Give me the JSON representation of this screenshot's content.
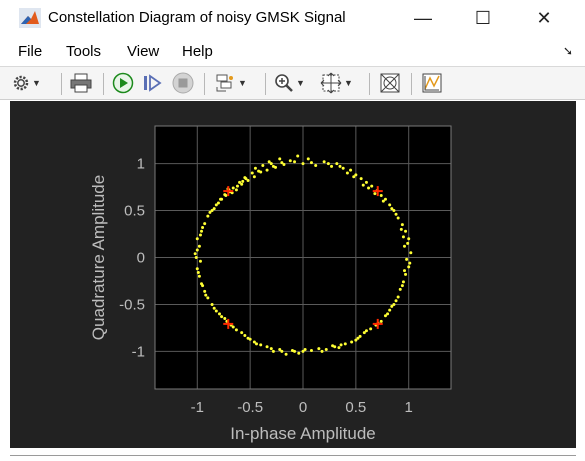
{
  "window": {
    "title": "Constellation Diagram of noisy GMSK Signal",
    "buttons": {
      "minimize": "—",
      "maximize": "☐",
      "close": "✕"
    }
  },
  "menu": {
    "items": [
      "File",
      "Tools",
      "View",
      "Help"
    ],
    "overflow_icon": "dock-arrow-icon"
  },
  "toolbar": {
    "buttons": [
      {
        "icon": "gear-icon",
        "dropdown": true
      },
      {
        "icon": "print-icon",
        "dropdown": false
      },
      {
        "icon": "run-icon",
        "dropdown": false
      },
      {
        "icon": "step-forward-icon",
        "dropdown": false
      },
      {
        "icon": "stop-icon",
        "dropdown": false
      },
      {
        "icon": "highlight-icon",
        "dropdown": true
      },
      {
        "icon": "zoom-in-icon",
        "dropdown": true
      },
      {
        "icon": "scale-axes-icon",
        "dropdown": true
      },
      {
        "icon": "measurements-icon",
        "dropdown": false
      },
      {
        "icon": "triggers-icon",
        "dropdown": false
      }
    ]
  },
  "chart_data": {
    "type": "scatter",
    "xlabel": "In-phase Amplitude",
    "ylabel": "Quadrature Amplitude",
    "xlim": [
      -1.4,
      1.4
    ],
    "ylim": [
      -1.4,
      1.4
    ],
    "xticks": [
      -1,
      -0.5,
      0,
      0.5,
      1
    ],
    "xtick_labels": [
      "-1",
      "-0.5",
      "0",
      "0.5",
      "1"
    ],
    "yticks": [
      1,
      0.5,
      0,
      -0.5,
      -1
    ],
    "ytick_labels": [
      "1",
      "0.5",
      "0",
      "-0.5",
      "-1"
    ],
    "grid": true,
    "reference_points": [
      {
        "x": -0.707,
        "y": 0.707
      },
      {
        "x": 0.707,
        "y": 0.707
      },
      {
        "x": -0.707,
        "y": -0.707
      },
      {
        "x": 0.707,
        "y": -0.707
      }
    ],
    "received_points": [
      [
        -0.71,
        0.73
      ],
      [
        -0.69,
        0.7
      ],
      [
        -0.74,
        0.67
      ],
      [
        -0.66,
        0.74
      ],
      [
        -0.78,
        0.62
      ],
      [
        -0.6,
        0.8
      ],
      [
        -0.55,
        0.85
      ],
      [
        -0.48,
        0.9
      ],
      [
        -0.45,
        0.95
      ],
      [
        -0.38,
        0.98
      ],
      [
        -0.32,
        1.02
      ],
      [
        -0.28,
        0.97
      ],
      [
        -0.22,
        1.05
      ],
      [
        -0.18,
        0.99
      ],
      [
        -0.12,
        1.03
      ],
      [
        -0.05,
        1.08
      ],
      [
        0.0,
        1.0
      ],
      [
        0.05,
        1.05
      ],
      [
        0.12,
        0.98
      ],
      [
        0.2,
        1.02
      ],
      [
        0.27,
        0.97
      ],
      [
        0.32,
        1.0
      ],
      [
        0.38,
        0.95
      ],
      [
        0.45,
        0.93
      ],
      [
        0.5,
        0.88
      ],
      [
        0.55,
        0.84
      ],
      [
        0.6,
        0.8
      ],
      [
        0.65,
        0.76
      ],
      [
        0.7,
        0.71
      ],
      [
        0.74,
        0.66
      ],
      [
        0.78,
        0.62
      ],
      [
        0.82,
        0.56
      ],
      [
        0.86,
        0.5
      ],
      [
        0.9,
        0.42
      ],
      [
        0.94,
        0.35
      ],
      [
        0.97,
        0.28
      ],
      [
        1.0,
        0.2
      ],
      [
        0.96,
        0.12
      ],
      [
        1.02,
        0.05
      ],
      [
        0.98,
        -0.02
      ],
      [
        1.0,
        -0.1
      ],
      [
        0.97,
        -0.18
      ],
      [
        0.95,
        -0.26
      ],
      [
        0.92,
        -0.34
      ],
      [
        0.9,
        -0.42
      ],
      [
        0.86,
        -0.5
      ],
      [
        0.82,
        -0.56
      ],
      [
        0.78,
        -0.62
      ],
      [
        0.74,
        -0.68
      ],
      [
        0.69,
        -0.72
      ],
      [
        0.64,
        -0.76
      ],
      [
        0.58,
        -0.8
      ],
      [
        0.52,
        -0.86
      ],
      [
        0.46,
        -0.9
      ],
      [
        0.4,
        -0.92
      ],
      [
        0.34,
        -0.96
      ],
      [
        0.28,
        -0.94
      ],
      [
        0.22,
        -0.98
      ],
      [
        0.15,
        -0.97
      ],
      [
        0.08,
        -0.99
      ],
      [
        0.02,
        -0.98
      ],
      [
        -0.04,
        -1.02
      ],
      [
        -0.1,
        -0.99
      ],
      [
        -0.16,
        -1.03
      ],
      [
        -0.22,
        -0.98
      ],
      [
        -0.28,
        -1.0
      ],
      [
        -0.34,
        -0.95
      ],
      [
        -0.4,
        -0.93
      ],
      [
        -0.46,
        -0.9
      ],
      [
        -0.52,
        -0.86
      ],
      [
        -0.58,
        -0.8
      ],
      [
        -0.63,
        -0.77
      ],
      [
        -0.68,
        -0.72
      ],
      [
        -0.72,
        -0.68
      ],
      [
        -0.77,
        -0.63
      ],
      [
        -0.82,
        -0.57
      ],
      [
        -0.86,
        -0.5
      ],
      [
        -0.9,
        -0.43
      ],
      [
        -0.93,
        -0.36
      ],
      [
        -0.96,
        -0.28
      ],
      [
        -0.98,
        -0.2
      ],
      [
        -1.0,
        -0.12
      ],
      [
        -0.97,
        -0.04
      ],
      [
        -1.02,
        0.04
      ],
      [
        -0.98,
        0.12
      ],
      [
        -1.0,
        0.2
      ],
      [
        -0.96,
        0.28
      ],
      [
        -0.93,
        0.36
      ],
      [
        -0.9,
        0.44
      ],
      [
        -0.86,
        0.5
      ],
      [
        -0.82,
        0.56
      ],
      [
        -0.77,
        0.62
      ],
      [
        -0.73,
        0.66
      ],
      [
        -0.67,
        0.69
      ],
      [
        -0.63,
        0.72
      ],
      [
        -0.58,
        0.78
      ],
      [
        -0.52,
        0.82
      ],
      [
        -0.46,
        0.86
      ],
      [
        -0.4,
        0.91
      ],
      [
        -0.34,
        0.93
      ],
      [
        0.42,
        0.9
      ],
      [
        0.48,
        0.86
      ],
      [
        0.57,
        0.77
      ],
      [
        0.62,
        0.74
      ],
      [
        0.68,
        0.68
      ],
      [
        0.76,
        0.6
      ],
      [
        0.84,
        0.52
      ],
      [
        0.93,
        0.3
      ],
      [
        0.99,
        0.15
      ],
      [
        1.01,
        -0.06
      ],
      [
        0.94,
        -0.3
      ],
      [
        0.88,
        -0.46
      ],
      [
        0.8,
        -0.6
      ],
      [
        0.71,
        -0.7
      ],
      [
        0.6,
        -0.78
      ],
      [
        0.5,
        -0.88
      ],
      [
        0.36,
        -0.93
      ],
      [
        0.18,
        -1.0
      ],
      [
        -0.08,
        -1.0
      ],
      [
        -0.3,
        -0.97
      ],
      [
        -0.44,
        -0.92
      ],
      [
        -0.55,
        -0.83
      ],
      [
        -0.66,
        -0.74
      ],
      [
        -0.74,
        -0.65
      ],
      [
        -0.84,
        -0.54
      ],
      [
        -0.92,
        -0.4
      ],
      [
        -0.99,
        -0.16
      ],
      [
        -1.0,
        0.08
      ],
      [
        -0.95,
        0.32
      ],
      [
        -0.88,
        0.48
      ],
      [
        -0.8,
        0.58
      ],
      [
        -0.7,
        0.72
      ],
      [
        -0.62,
        0.76
      ],
      [
        -0.54,
        0.84
      ],
      [
        -0.42,
        0.92
      ],
      [
        -0.3,
        1.0
      ],
      [
        -0.2,
        1.01
      ],
      [
        -0.08,
        1.02
      ],
      [
        0.08,
        1.01
      ],
      [
        0.24,
        1.0
      ],
      [
        0.35,
        0.97
      ],
      [
        0.88,
        0.46
      ],
      [
        0.95,
        0.22
      ],
      [
        0.96,
        -0.14
      ],
      [
        0.84,
        -0.52
      ],
      [
        0.54,
        -0.84
      ],
      [
        0.3,
        -0.95
      ],
      [
        0.0,
        -1.0
      ],
      [
        -0.2,
        -1.0
      ],
      [
        -0.5,
        -0.87
      ],
      [
        -0.79,
        -0.6
      ],
      [
        -0.95,
        -0.3
      ],
      [
        -1.01,
        0.0
      ],
      [
        -0.97,
        0.24
      ],
      [
        -0.84,
        0.52
      ],
      [
        -0.57,
        0.81
      ],
      [
        -0.26,
        0.96
      ]
    ],
    "colors": {
      "background": "#222222",
      "axes": "#000000",
      "grid": "#5a5a5a",
      "points": "#ffff33",
      "reference": "#ff2a00",
      "text": "#bdbdbd"
    }
  }
}
